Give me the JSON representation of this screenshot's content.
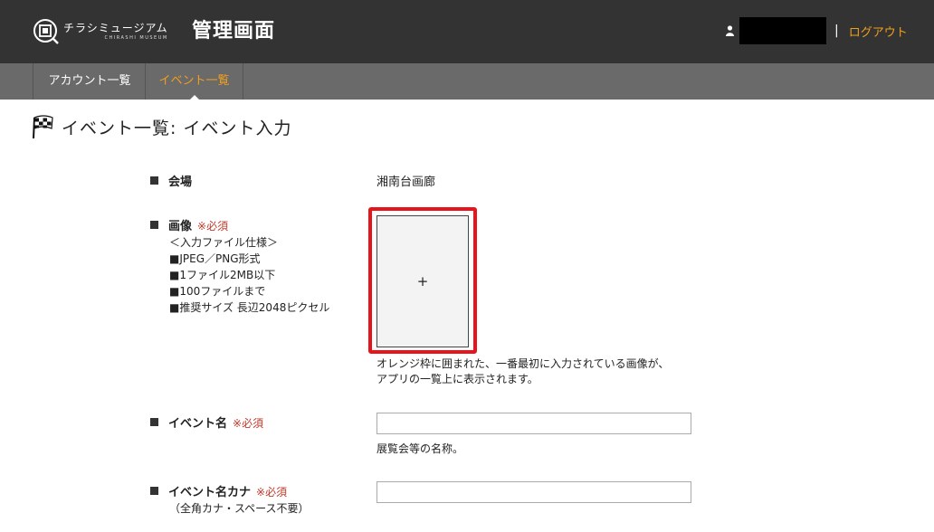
{
  "header": {
    "logo_name": "チラシミュージアム",
    "logo_sub": "CHIRASHI MUSEUM",
    "admin_title": "管理画面",
    "separator": "|",
    "logout_label": "ログアウト"
  },
  "nav": {
    "tabs": [
      {
        "label": "アカウント一覧",
        "active": false
      },
      {
        "label": "イベント一覧",
        "active": true
      }
    ],
    "active_color": "#f0a01c"
  },
  "page": {
    "title": "イベント一覧: イベント入力"
  },
  "form": {
    "venue": {
      "label": "会場",
      "value": "湘南台画廊"
    },
    "image": {
      "label": "画像",
      "required": "※必須",
      "spec": [
        "＜入力ファイル仕様＞",
        "■JPEG／PNG形式",
        "■1ファイル2MB以下",
        "■100ファイルまで",
        "■推奨サイズ 長辺2048ピクセル"
      ],
      "add_symbol": "+",
      "note_line1": "オレンジ枠に囲まれた、一番最初に入力されている画像が、",
      "note_line2": "アプリの一覧上に表示されます。"
    },
    "event_name": {
      "label": "イベント名",
      "required": "※必須",
      "value": "",
      "help": "展覧会等の名称。"
    },
    "event_kana": {
      "label": "イベント名カナ",
      "required": "※必須",
      "note": "（全角カナ・スペース不要）",
      "value": ""
    }
  },
  "icons": [
    "logo-mark-icon",
    "user-icon",
    "checkered-flag-icon",
    "plus-icon"
  ],
  "colors": {
    "header_bg": "#333333",
    "nav_bg": "#6a6a6a",
    "accent": "#f0a01c",
    "required": "#c0392b",
    "highlight_border": "#e8141b"
  }
}
